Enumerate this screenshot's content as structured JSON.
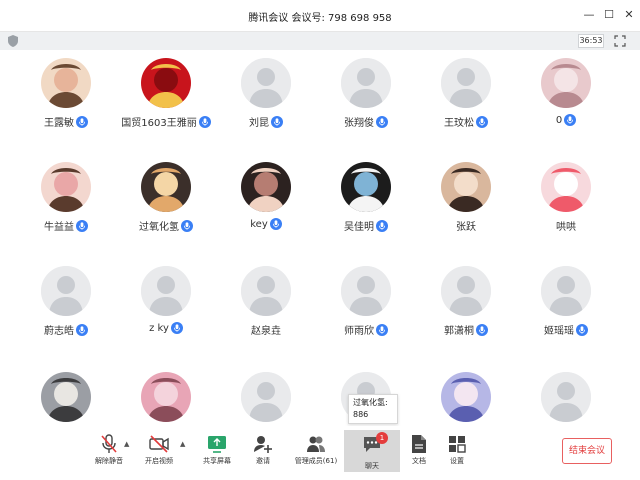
{
  "window": {
    "title": "腾讯会议 会议号: 798 698 958",
    "controls": [
      "minimize-icon",
      "maximize-icon",
      "close-icon"
    ]
  },
  "subbar": {
    "timer": "36:53"
  },
  "participants": [
    {
      "name": "王露敏",
      "avatar": "photo-child-girl",
      "mic": true
    },
    {
      "name": "国贸1603王雅丽",
      "avatar": "photo-red-festive",
      "mic": true
    },
    {
      "name": "刘昆",
      "avatar": "generic",
      "mic": true
    },
    {
      "name": "张翔俊",
      "avatar": "generic",
      "mic": true
    },
    {
      "name": "王玟松",
      "avatar": "generic",
      "mic": true
    },
    {
      "name": "0",
      "avatar": "photo-pink-sketch",
      "mic": true
    },
    {
      "name": "牛益益",
      "avatar": "photo-child-girl-2",
      "mic": true
    },
    {
      "name": "过氧化氢",
      "avatar": "photo-cat-sunset",
      "mic": true
    },
    {
      "name": "key",
      "avatar": "photo-girl-hands",
      "mic": true
    },
    {
      "name": "吴佳明",
      "avatar": "photo-white-cat",
      "mic": true
    },
    {
      "name": "张跃",
      "avatar": "photo-woman-lying",
      "mic": false
    },
    {
      "name": "哄哄",
      "avatar": "photo-pink-pig",
      "mic": false
    },
    {
      "name": "蔚志皓",
      "avatar": "generic",
      "mic": true
    },
    {
      "name": "z ky",
      "avatar": "generic",
      "mic": true
    },
    {
      "name": "赵泉垚",
      "avatar": "generic",
      "mic": false
    },
    {
      "name": "师雨欣",
      "avatar": "generic",
      "mic": true
    },
    {
      "name": "郭潇桐",
      "avatar": "generic",
      "mic": true
    },
    {
      "name": "姬瑶瑶",
      "avatar": "generic",
      "mic": true
    },
    {
      "name": "",
      "avatar": "photo-cat-grey",
      "mic": false
    },
    {
      "name": "",
      "avatar": "photo-pink-flowers",
      "mic": false
    },
    {
      "name": "",
      "avatar": "generic",
      "mic": false
    },
    {
      "name": "",
      "avatar": "generic",
      "mic": false
    },
    {
      "name": "",
      "avatar": "photo-anime-girl",
      "mic": false
    },
    {
      "name": "",
      "avatar": "generic",
      "mic": false
    }
  ],
  "tooltip": {
    "line1": "过氧化氢:",
    "line2": "886"
  },
  "toolbar": {
    "mute": "解除静音",
    "video": "开启视频",
    "share": "共享屏幕",
    "invite": "邀请",
    "members": "管理成员(61)",
    "chat": "聊天",
    "chat_badge": "1",
    "docs": "文档",
    "settings": "设置",
    "end": "结束会议"
  },
  "colors": {
    "mic_blue": "#3a7ff5",
    "end_red": "#e23b3b",
    "share_green": "#2aa56b",
    "placeholder": "#e9eaec"
  }
}
